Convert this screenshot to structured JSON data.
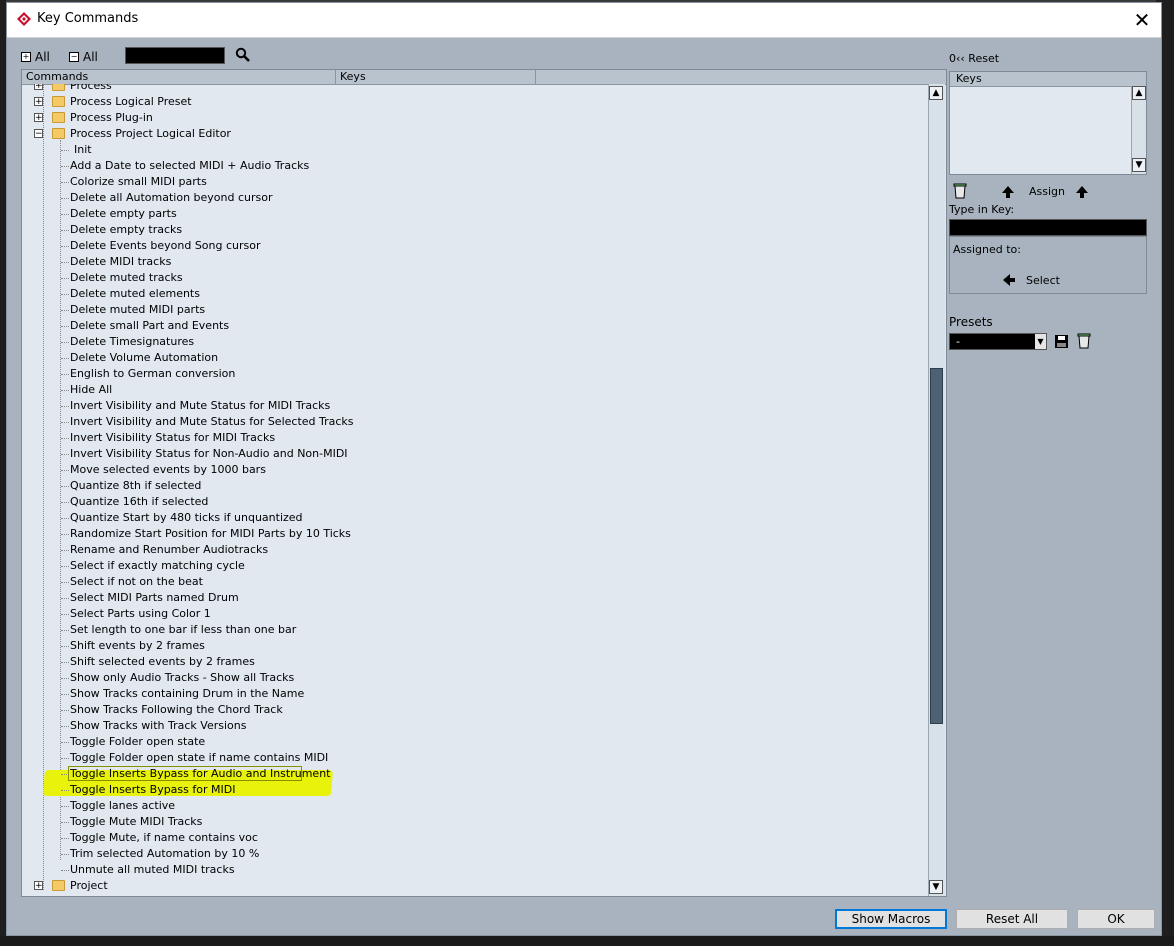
{
  "window": {
    "title": "Key Commands",
    "close_glyph": "✕"
  },
  "toolbar": {
    "expand_all_label": "All",
    "collapse_all_label": "All",
    "search_value": ""
  },
  "tree": {
    "columns": [
      "Commands",
      "Keys"
    ],
    "folders": [
      {
        "label": "Process",
        "expanded": false
      },
      {
        "label": "Process Logical Preset",
        "expanded": false
      },
      {
        "label": "Process Plug-in",
        "expanded": false
      },
      {
        "label": "Process Project Logical Editor",
        "expanded": true
      },
      {
        "label": "Project",
        "expanded": false
      }
    ],
    "items": [
      "Init",
      "Add  a Date to selected MIDI + Audio Tracks",
      "Colorize small MIDI parts",
      "Delete all Automation beyond cursor",
      "Delete empty parts",
      "Delete empty tracks",
      "Delete Events beyond Song cursor",
      "Delete MIDI tracks",
      "Delete muted  tracks",
      "Delete muted elements",
      "Delete muted MIDI parts",
      "Delete small Part and Events",
      "Delete Timesignatures",
      "Delete Volume Automation",
      "English to German conversion",
      "Hide All",
      "Invert Visibility and Mute Status for MIDI Tracks",
      "Invert Visibility and Mute Status for Selected Tracks",
      "Invert Visibility Status for MIDI Tracks",
      "Invert Visibility Status for Non-Audio and Non-MIDI",
      "Move selected events by 1000 bars",
      "Quantize 8th if selected",
      "Quantize 16th if selected",
      "Quantize Start by 480 ticks if unquantized",
      "Randomize Start Position for MIDI Parts by 10 Ticks",
      "Rename and Renumber Audiotracks",
      "Select if exactly matching cycle",
      "Select if not on the beat",
      "Select MIDI Parts named Drum",
      "Select Parts using Color 1",
      "Set length to one bar  if less than one bar",
      "Shift events by 2 frames",
      "Shift selected events by 2 frames",
      "Show only Audio Tracks - Show all Tracks",
      "Show Tracks containing Drum in the Name",
      "Show Tracks Following the Chord Track",
      "Show Tracks with Track Versions",
      "Toggle Folder open state",
      "Toggle Folder open state if name contains MIDI",
      "Toggle Inserts Bypass for Audio and Instrument",
      "Toggle Inserts Bypass for MIDI",
      "Toggle lanes active",
      "Toggle Mute MIDI Tracks",
      "Toggle Mute, if name contains voc",
      "Trim  selected Automation by 10 %",
      "Unmute all muted MIDI tracks"
    ],
    "selected_item": "Toggle Inserts Bypass for Audio and Instrument"
  },
  "right_panel": {
    "reset_label": "Reset",
    "keys_header": "Keys",
    "assign_label": "Assign",
    "type_in_key_label": "Type in Key:",
    "type_in_key_value": "",
    "assigned_to_label": "Assigned to:",
    "select_label": "Select",
    "presets_label": "Presets",
    "presets_value": "-"
  },
  "buttons": {
    "show_macros": "Show Macros",
    "reset_all": "Reset All",
    "ok": "OK"
  },
  "colors": {
    "dialog_bg": "#a8b3bf",
    "tree_bg": "#e1e8f0",
    "highlight": "#e8f20a",
    "scroll_thumb": "#4d6175",
    "folder": "#f4c968"
  }
}
